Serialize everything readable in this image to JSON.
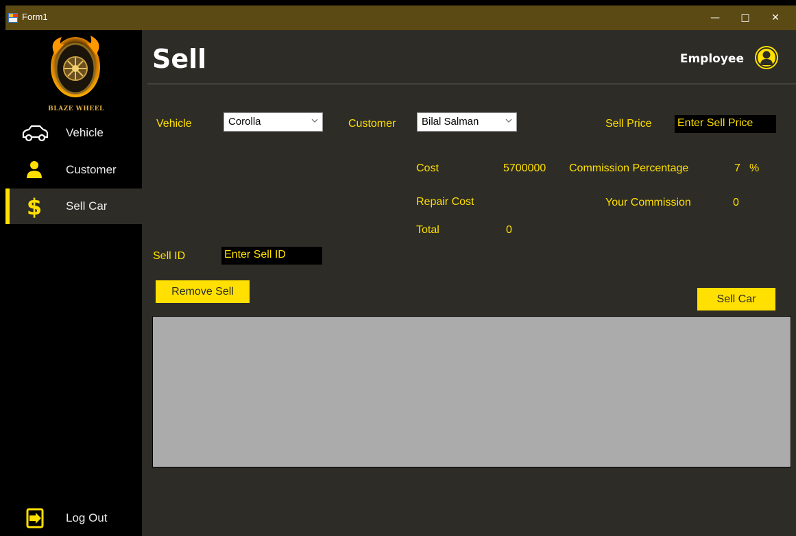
{
  "window": {
    "title": "Form1",
    "minimize_glyph": "—",
    "maximize_glyph": "□",
    "close_glyph": "✕"
  },
  "sidebar": {
    "logo_text": "BLAZE WHEEL",
    "items": [
      {
        "label": "Vehicle",
        "icon": "car-icon"
      },
      {
        "label": "Customer",
        "icon": "person-icon"
      },
      {
        "label": "Sell Car",
        "icon": "dollar-icon",
        "active": true
      }
    ],
    "logout_label": "Log Out"
  },
  "header": {
    "title": "Sell",
    "user_role": "Employee"
  },
  "form": {
    "vehicle_label": "Vehicle",
    "vehicle_value": "Corolla",
    "customer_label": "Customer",
    "customer_value": "Bilal Salman",
    "sell_price_label": "Sell Price",
    "sell_price_placeholder": "Enter Sell Price",
    "cost_label": "Cost",
    "cost_value": "5700000",
    "commission_pct_label": "Commission Percentage",
    "commission_pct_value": "7",
    "commission_pct_unit": "%",
    "repair_cost_label": "Repair Cost",
    "your_commission_label": "Your Commission",
    "your_commission_value": "0",
    "total_label": "Total",
    "total_value": "0",
    "sell_id_label": "Sell ID",
    "sell_id_placeholder": "Enter Sell ID"
  },
  "actions": {
    "remove_sell": "Remove Sell",
    "sell_car": "Sell Car"
  },
  "colors": {
    "accent": "#ffe000",
    "titlebar": "#5b4a14",
    "main_bg": "#2d2c27",
    "sidebar_bg": "#000000",
    "grid_bg": "#ababab"
  }
}
